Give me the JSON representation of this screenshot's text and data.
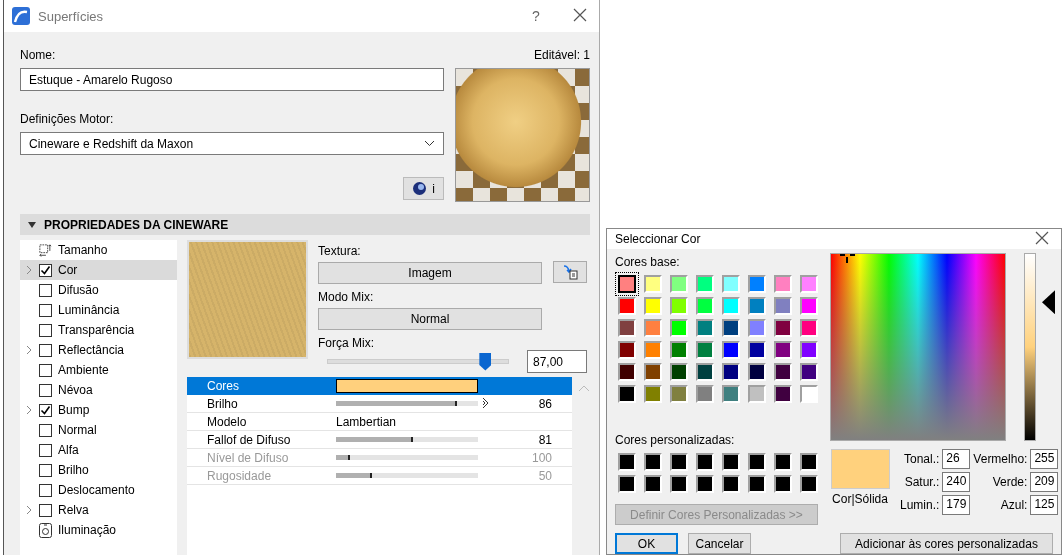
{
  "window": {
    "title": "Superfícies",
    "help": "?"
  },
  "name": {
    "label": "Nome:",
    "value": "Estuque - Amarelo Rugoso"
  },
  "editable": "Editável: 1",
  "engine": {
    "label": "Definições Motor:",
    "value": "Cineware e Redshift da Maxon"
  },
  "info_button": "i",
  "section": {
    "title": "PROPRIEDADES DA CINEWARE",
    "expanded": true
  },
  "channels": [
    {
      "label": "Tamanho",
      "kind": "size",
      "expandable": false,
      "selected": false
    },
    {
      "label": "Cor",
      "kind": "checkbox",
      "checked": true,
      "expandable": true,
      "selected": true
    },
    {
      "label": "Difusão",
      "kind": "checkbox",
      "checked": false,
      "expandable": false,
      "selected": false
    },
    {
      "label": "Luminância",
      "kind": "checkbox",
      "checked": false,
      "expandable": false,
      "selected": false
    },
    {
      "label": "Transparência",
      "kind": "checkbox",
      "checked": false,
      "expandable": false,
      "selected": false
    },
    {
      "label": "Reflectância",
      "kind": "checkbox",
      "checked": false,
      "expandable": true,
      "selected": false
    },
    {
      "label": "Ambiente",
      "kind": "checkbox",
      "checked": false,
      "expandable": false,
      "selected": false
    },
    {
      "label": "Névoa",
      "kind": "checkbox",
      "checked": false,
      "expandable": false,
      "selected": false
    },
    {
      "label": "Bump",
      "kind": "checkbox",
      "checked": true,
      "expandable": true,
      "selected": false
    },
    {
      "label": "Normal",
      "kind": "checkbox",
      "checked": false,
      "expandable": false,
      "selected": false
    },
    {
      "label": "Alfa",
      "kind": "checkbox",
      "checked": false,
      "expandable": false,
      "selected": false
    },
    {
      "label": "Brilho",
      "kind": "checkbox",
      "checked": false,
      "expandable": false,
      "selected": false
    },
    {
      "label": "Deslocamento",
      "kind": "checkbox",
      "checked": false,
      "expandable": false,
      "selected": false
    },
    {
      "label": "Relva",
      "kind": "checkbox",
      "checked": false,
      "expandable": true,
      "selected": false
    },
    {
      "label": "Iluminação",
      "kind": "light",
      "expandable": false,
      "selected": false
    }
  ],
  "texture": {
    "label": "Textura:",
    "value": "Imagem"
  },
  "mix_mode": {
    "label": "Modo Mix:",
    "value": "Normal"
  },
  "mix_strength": {
    "label": "Força Mix:",
    "level": 0.87,
    "value": "87,00"
  },
  "properties": [
    {
      "label": "Cores",
      "kind": "color",
      "color": "#ffd07d",
      "selected": true,
      "disabled": false
    },
    {
      "label": "Brilho",
      "kind": "slider",
      "level": 0.85,
      "value": "86",
      "marker": true,
      "selected": false,
      "disabled": false
    },
    {
      "label": "Modelo",
      "kind": "text",
      "value": "Lambertian",
      "selected": false,
      "disabled": false
    },
    {
      "label": "Fallof de Difuso",
      "kind": "slider",
      "level": 0.54,
      "value": "81",
      "marker": false,
      "selected": false,
      "disabled": false
    },
    {
      "label": "Nível de Difuso",
      "kind": "slider",
      "level": 0.1,
      "value": "100",
      "marker": false,
      "selected": false,
      "disabled": true
    },
    {
      "label": "Rugosidade",
      "kind": "slider",
      "level": 0.25,
      "value": "50",
      "marker": false,
      "selected": false,
      "disabled": true
    }
  ],
  "color_picker": {
    "title": "Seleccionar Cor",
    "base_label": "Cores base:",
    "base_colors": [
      {
        "color": "#ff8080",
        "selected": true
      },
      {
        "color": "#ffff80",
        "selected": false
      },
      {
        "color": "#80ff80",
        "selected": false
      },
      {
        "color": "#00ff80",
        "selected": false
      },
      {
        "color": "#80ffff",
        "selected": false
      },
      {
        "color": "#0080ff",
        "selected": false
      },
      {
        "color": "#ff80c0",
        "selected": false
      },
      {
        "color": "#ff80ff",
        "selected": false
      },
      {
        "color": "#ff0000",
        "selected": false
      },
      {
        "color": "#ffff00",
        "selected": false
      },
      {
        "color": "#80ff00",
        "selected": false
      },
      {
        "color": "#00ff40",
        "selected": false
      },
      {
        "color": "#00ffff",
        "selected": false
      },
      {
        "color": "#0080c0",
        "selected": false
      },
      {
        "color": "#8080c0",
        "selected": false
      },
      {
        "color": "#ff00ff",
        "selected": false
      },
      {
        "color": "#804040",
        "selected": false
      },
      {
        "color": "#ff8040",
        "selected": false
      },
      {
        "color": "#00ff00",
        "selected": false
      },
      {
        "color": "#008080",
        "selected": false
      },
      {
        "color": "#004080",
        "selected": false
      },
      {
        "color": "#8080ff",
        "selected": false
      },
      {
        "color": "#800040",
        "selected": false
      },
      {
        "color": "#ff0080",
        "selected": false
      },
      {
        "color": "#800000",
        "selected": false
      },
      {
        "color": "#ff8000",
        "selected": false
      },
      {
        "color": "#008000",
        "selected": false
      },
      {
        "color": "#008040",
        "selected": false
      },
      {
        "color": "#0000ff",
        "selected": false
      },
      {
        "color": "#0000a0",
        "selected": false
      },
      {
        "color": "#800080",
        "selected": false
      },
      {
        "color": "#8000ff",
        "selected": false
      },
      {
        "color": "#400000",
        "selected": false
      },
      {
        "color": "#804000",
        "selected": false
      },
      {
        "color": "#004000",
        "selected": false
      },
      {
        "color": "#004040",
        "selected": false
      },
      {
        "color": "#000080",
        "selected": false
      },
      {
        "color": "#000040",
        "selected": false
      },
      {
        "color": "#400040",
        "selected": false
      },
      {
        "color": "#400080",
        "selected": false
      },
      {
        "color": "#000000",
        "selected": false
      },
      {
        "color": "#808000",
        "selected": false
      },
      {
        "color": "#808040",
        "selected": false
      },
      {
        "color": "#808080",
        "selected": false
      },
      {
        "color": "#408080",
        "selected": false
      },
      {
        "color": "#c0c0c0",
        "selected": false
      },
      {
        "color": "#400040",
        "selected": false
      },
      {
        "color": "#ffffff",
        "selected": false
      }
    ],
    "custom_label": "Cores personalizadas:",
    "custom_colors": [
      {
        "color": "#000000"
      },
      {
        "color": "#000000"
      },
      {
        "color": "#000000"
      },
      {
        "color": "#000000"
      },
      {
        "color": "#000000"
      },
      {
        "color": "#000000"
      },
      {
        "color": "#000000"
      },
      {
        "color": "#000000"
      },
      {
        "color": "#000000"
      },
      {
        "color": "#000000"
      },
      {
        "color": "#000000"
      },
      {
        "color": "#000000"
      },
      {
        "color": "#000000"
      },
      {
        "color": "#000000"
      },
      {
        "color": "#000000"
      },
      {
        "color": "#000000"
      }
    ],
    "define_button": {
      "label": "Definir Cores Personalizadas >>",
      "disabled": true
    },
    "luminance": {
      "level": 0.74
    },
    "current": {
      "color": "#ffd17d"
    },
    "current_label": "Cor|Sólida",
    "fields": [
      {
        "label": "Tonal.:",
        "value": "26"
      },
      {
        "label": "Vermelho:",
        "value": "255"
      },
      {
        "label": "Satur.:",
        "value": "240"
      },
      {
        "label": "Verde:",
        "value": "209"
      },
      {
        "label": "Lumin.:",
        "value": "179"
      },
      {
        "label": "Azul:",
        "value": "125"
      }
    ],
    "ok": "OK",
    "cancel": "Cancelar",
    "add_button": "Adicionar às cores personalizadas"
  }
}
